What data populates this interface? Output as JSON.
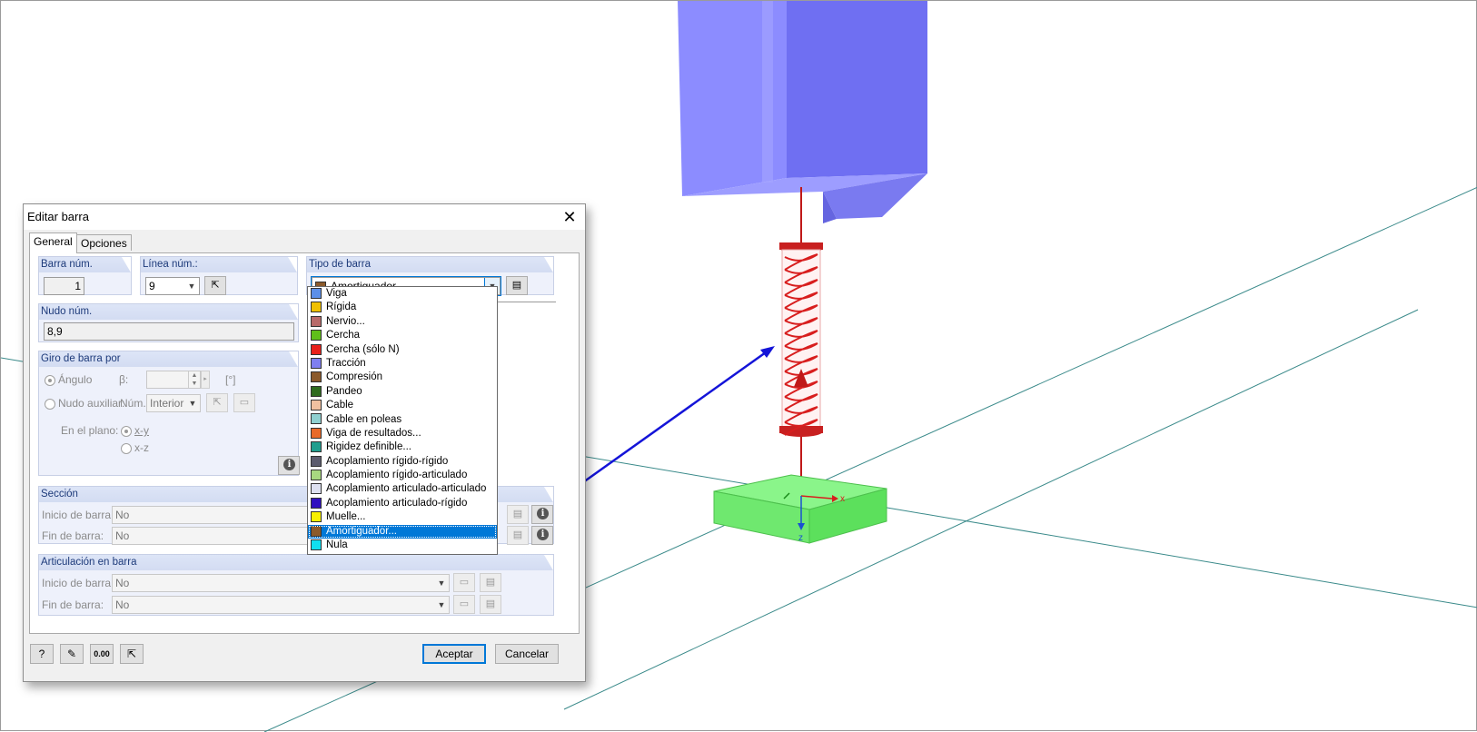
{
  "dialog": {
    "title": "Editar barra",
    "tabs": [
      {
        "label": "General",
        "active": true
      },
      {
        "label": "Opciones",
        "active": false
      }
    ],
    "member_no": {
      "header": "Barra núm.",
      "value": "1"
    },
    "line_no": {
      "header": "Línea núm.:",
      "value": "9"
    },
    "member_type": {
      "header": "Tipo de barra",
      "selected": "Amortiguador...",
      "selected_color": "#8b5a2b"
    },
    "node_no": {
      "header": "Nudo núm.",
      "value": "8,9"
    },
    "rotation": {
      "header": "Giro de barra por",
      "angle_label": "Ángulo",
      "beta_label": "β:",
      "beta_unit": "[°]",
      "helper_node_label": "Nudo auxiliar:",
      "num_label": "Núm.:",
      "num_value": "Interior",
      "plane_label": "En el plano:",
      "plane_xy": "x-y",
      "plane_xz": "x-z"
    },
    "section": {
      "header": "Sección",
      "start_label": "Inicio de barra:",
      "start_value": "No",
      "end_label": "Fin de barra:",
      "end_value": "No"
    },
    "hinge": {
      "header": "Articulación en barra",
      "start_label": "Inicio de barra:",
      "start_value": "No",
      "end_label": "Fin de barra:",
      "end_value": "No"
    },
    "ok_label": "Aceptar",
    "cancel_label": "Cancelar",
    "footer_icons": [
      "help-icon",
      "edit-icon",
      "units-icon",
      "pick-icon"
    ],
    "units_icon_text": "0.00"
  },
  "dropdown": {
    "items": [
      {
        "label": "Viga",
        "color": "#5b8fe8"
      },
      {
        "label": "Rígida",
        "color": "#f0c000"
      },
      {
        "label": "Nervio...",
        "color": "#b86a6a"
      },
      {
        "label": "Cercha",
        "color": "#5fbf1a"
      },
      {
        "label": "Cercha (sólo N)",
        "color": "#e8201a"
      },
      {
        "label": "Tracción",
        "color": "#7f7ff0"
      },
      {
        "label": "Compresión",
        "color": "#8b5a2b"
      },
      {
        "label": "Pandeo",
        "color": "#2e6b1e"
      },
      {
        "label": "Cable",
        "color": "#f0c0a0"
      },
      {
        "label": "Cable en poleas",
        "color": "#8fd0d0"
      },
      {
        "label": "Viga de resultados...",
        "color": "#e86a2a"
      },
      {
        "label": "Rigidez definible...",
        "color": "#1f9e8e"
      },
      {
        "label": "Acoplamiento rígido-rígido",
        "color": "#5c5c6e"
      },
      {
        "label": "Acoplamiento rígido-articulado",
        "color": "#a8d880"
      },
      {
        "label": "Acoplamiento articulado-articulado",
        "color": "#dde0f0"
      },
      {
        "label": "Acoplamiento articulado-rígido",
        "color": "#3010c0"
      },
      {
        "label": "Muelle...",
        "color": "#f8f000"
      },
      {
        "label": "Amortiguador...",
        "color": "#8b5a2b",
        "selected": true
      },
      {
        "label": "Nula",
        "color": "#10e0f0"
      }
    ]
  },
  "scene": {
    "axis_x_label": "x",
    "axis_z_label": "z",
    "colors": {
      "beam": "#7878f5",
      "spring": "#d81e1e",
      "support": "#7cf07c",
      "arrow": "#1414d8"
    }
  }
}
